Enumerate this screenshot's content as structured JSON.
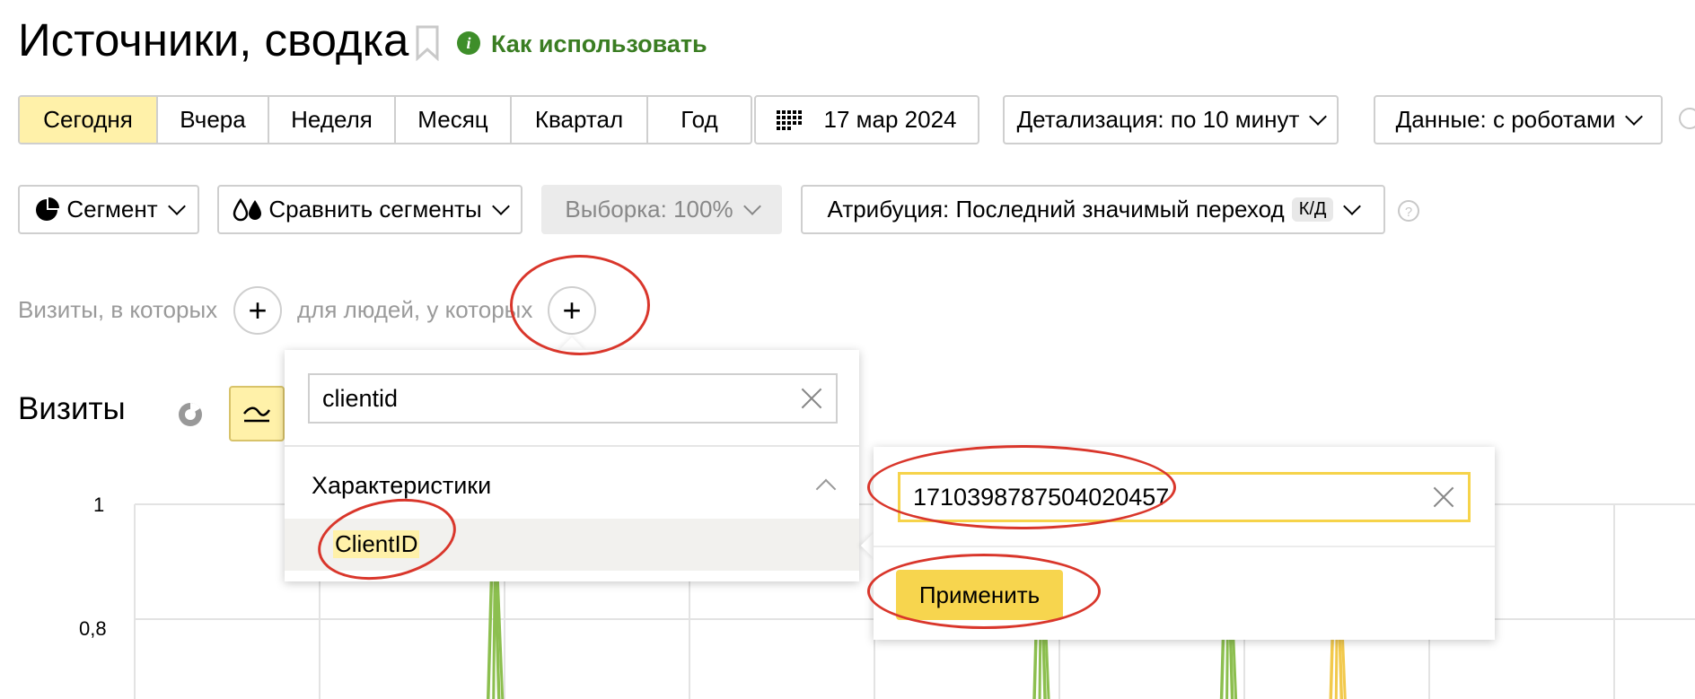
{
  "header": {
    "title": "Источники, сводка",
    "how_to_link": "Как использовать",
    "info_icon_glyph": "i"
  },
  "periods": [
    {
      "label": "Сегодня",
      "active": true
    },
    {
      "label": "Вчера",
      "active": false
    },
    {
      "label": "Неделя",
      "active": false
    },
    {
      "label": "Месяц",
      "active": false
    },
    {
      "label": "Квартал",
      "active": false
    },
    {
      "label": "Год",
      "active": false
    }
  ],
  "date_picker": {
    "label": "17 мар 2024"
  },
  "detail_select": {
    "label": "Детализация: по 10 минут"
  },
  "data_select": {
    "label": "Данные: с роботами"
  },
  "segment_bar": {
    "segment_label": "Сегмент",
    "compare_label": "Сравнить сегменты",
    "sample_label": "Выборка: 100%",
    "attribution_label": "Атрибуция: Последний значимый переход",
    "attribution_badge": "к/д"
  },
  "filters": {
    "visits_label": "Визиты, в которых",
    "people_label": "для людей, у которых",
    "plus_glyph": "+"
  },
  "condition_dropdown": {
    "search_value": "clientid",
    "section_title": "Характеристики",
    "item_label": "ClientID"
  },
  "value_popup": {
    "input_value": "1710398787504020457",
    "apply_label": "Применить"
  },
  "chart_section": {
    "title": "Визиты"
  },
  "chart_data": {
    "type": "line",
    "title": "",
    "xlabel": "",
    "ylabel": "",
    "ylim": [
      0,
      1
    ],
    "y_ticks": [
      {
        "value": 1,
        "label": "1"
      },
      {
        "value": 0.8,
        "label": "0,8"
      }
    ],
    "grid": true,
    "x_count": 100,
    "series": [
      {
        "color": "#8cbf4f",
        "points": [
          {
            "x": 23,
            "y": 1
          },
          {
            "x": 58,
            "y": 1
          },
          {
            "x": 70,
            "y": 1
          }
        ]
      },
      {
        "color": "#f2c94c",
        "points": [
          {
            "x": 77,
            "y": 1
          }
        ]
      }
    ]
  },
  "colors": {
    "accent_yellow": "#fff1a9",
    "apply_yellow": "#f7d54e",
    "link_green": "#3a7d22",
    "annotation_red": "#d9362b"
  }
}
